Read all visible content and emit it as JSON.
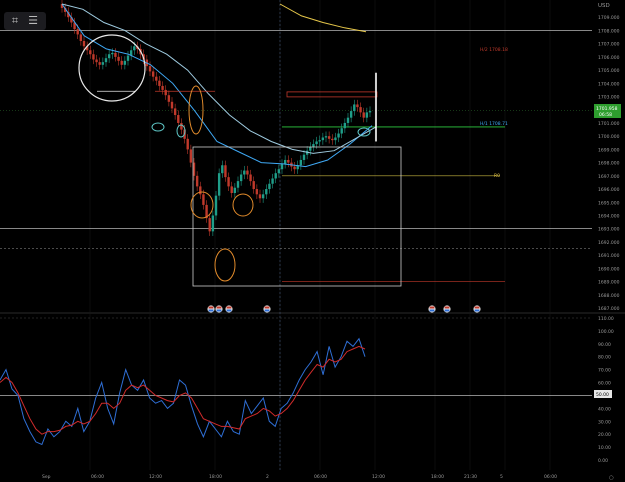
{
  "toolbar": {
    "frame_icon": "frame-icon",
    "list_icon": "list-icon"
  },
  "currency": "USD",
  "colors": {
    "background": "#000000",
    "candle_up": "#1f9e89",
    "candle_down": "#c0392b",
    "ma_fast": "#3fa9f5",
    "ma_mid": "#9ecbe0",
    "ma_slow": "#e6c74a",
    "hline": "#d9d9d9",
    "green_line": "#2ecc40",
    "orange": "#e08a2b",
    "red_box": "#c0392b",
    "osc_blue": "#2f6fd6",
    "osc_red": "#d12b2b",
    "price_tag": "#2e9e2e"
  },
  "chart_data": [
    {
      "type": "line",
      "title": "",
      "subtitle": "",
      "xlabel": "",
      "ylabel": "USD",
      "ylim": [
        1687.0,
        1710.0
      ],
      "y_ticks": [
        "1709.000",
        "1708.000",
        "1707.000",
        "1706.000",
        "1705.000",
        "1704.000",
        "1703.000",
        "1702.000",
        "1701.000",
        "1700.000",
        "1699.000",
        "1698.000",
        "1697.000",
        "1696.000",
        "1695.000",
        "1694.000",
        "1693.000",
        "1692.000",
        "1691.000",
        "1690.000",
        "1689.000",
        "1688.000",
        "1687.000"
      ],
      "x_ticks": [
        "Sep",
        "06:00",
        "12:00",
        "18:00",
        "2",
        "06:00",
        "12:00",
        "18:00",
        "21:30",
        "5",
        "06:00"
      ],
      "current_price": {
        "value": "1701.958",
        "countdown": "06:58",
        "numeric": 1701.958
      },
      "annotations": {
        "h2": "H/2 1708.18",
        "h1": "H/1 1708.71",
        "r0": "R0"
      },
      "series": [
        {
          "type": "candlestick",
          "x": [
            1,
            2,
            3,
            4,
            5,
            6,
            7,
            8,
            9,
            10,
            11,
            12,
            13,
            14,
            15,
            16,
            17,
            18,
            19,
            20,
            21,
            22,
            23,
            24,
            25,
            26,
            27,
            28,
            29,
            30,
            31,
            32,
            33,
            34,
            35,
            36,
            37,
            38,
            39,
            40,
            41,
            42,
            43,
            44,
            45,
            46,
            47,
            48,
            49,
            50,
            51,
            52,
            53,
            54,
            55,
            56,
            57,
            58,
            59,
            60,
            61,
            62,
            63,
            64,
            65,
            66,
            67,
            68,
            69,
            70,
            71,
            72,
            73,
            74,
            75,
            76,
            77,
            78,
            79,
            80,
            81,
            82,
            83,
            84,
            85,
            86,
            87,
            88,
            89,
            90,
            91,
            92,
            93,
            94,
            95,
            96,
            97,
            98,
            99
          ],
          "open": [
            1710.0,
            1709.7,
            1709.4,
            1709.0,
            1708.6,
            1708.1,
            1707.7,
            1707.2,
            1706.8,
            1706.5,
            1706.2,
            1705.8,
            1705.6,
            1705.4,
            1705.6,
            1705.9,
            1706.2,
            1706.3,
            1706.0,
            1705.7,
            1705.4,
            1705.7,
            1706.1,
            1706.5,
            1706.8,
            1706.6,
            1706.2,
            1705.8,
            1705.3,
            1704.9,
            1704.5,
            1704.2,
            1703.8,
            1703.5,
            1703.1,
            1702.6,
            1702.1,
            1701.6,
            1701.0,
            1700.5,
            1699.8,
            1699.0,
            1698.0,
            1697.0,
            1696.2,
            1695.6,
            1694.8,
            1693.8,
            1692.8,
            1694.0,
            1695.5,
            1697.2,
            1697.8,
            1696.9,
            1696.2,
            1695.7,
            1696.1,
            1696.6,
            1697.1,
            1697.4,
            1697.1,
            1696.6,
            1696.0,
            1695.6,
            1695.3,
            1695.6,
            1696.0,
            1696.4,
            1696.8,
            1697.2,
            1697.5,
            1697.9,
            1698.2,
            1698.0,
            1697.7,
            1697.5,
            1697.8,
            1698.2,
            1698.6,
            1698.9,
            1699.2,
            1699.4,
            1699.6,
            1699.7,
            1699.9,
            1700.0,
            1699.8,
            1699.7,
            1699.9,
            1700.2,
            1700.6,
            1701.0,
            1701.4,
            1701.9,
            1702.4,
            1702.2,
            1701.8,
            1701.4,
            1701.8
          ],
          "close": [
            1709.7,
            1709.4,
            1709.0,
            1708.6,
            1708.1,
            1707.7,
            1707.2,
            1706.8,
            1706.5,
            1706.2,
            1705.8,
            1705.6,
            1705.4,
            1705.6,
            1705.9,
            1706.2,
            1706.3,
            1706.0,
            1705.7,
            1705.4,
            1705.7,
            1706.1,
            1706.5,
            1706.8,
            1706.6,
            1706.2,
            1705.8,
            1705.3,
            1704.9,
            1704.5,
            1704.2,
            1703.8,
            1703.5,
            1703.1,
            1702.6,
            1702.1,
            1701.6,
            1701.0,
            1700.5,
            1699.8,
            1699.0,
            1698.0,
            1697.0,
            1696.2,
            1695.6,
            1694.8,
            1693.8,
            1692.8,
            1694.0,
            1695.5,
            1697.2,
            1697.8,
            1696.9,
            1696.2,
            1695.7,
            1696.1,
            1696.6,
            1697.1,
            1697.4,
            1697.1,
            1696.6,
            1696.0,
            1695.6,
            1695.3,
            1695.6,
            1696.0,
            1696.4,
            1696.8,
            1697.2,
            1697.5,
            1697.9,
            1698.2,
            1698.0,
            1697.7,
            1697.5,
            1697.8,
            1698.2,
            1698.6,
            1698.9,
            1699.2,
            1699.4,
            1699.6,
            1699.7,
            1699.9,
            1700.0,
            1699.8,
            1699.7,
            1699.9,
            1700.2,
            1700.6,
            1701.0,
            1701.4,
            1701.9,
            1702.4,
            1702.2,
            1701.8,
            1701.4,
            1701.8,
            1701.9
          ]
        },
        {
          "name": "",
          "values": [
            1710.0,
            1707.6,
            1706.6,
            1706.2,
            1705.4,
            1704.0,
            1701.9,
            1699.6,
            1698.8,
            1698.0,
            1697.9,
            1697.7,
            1698.2,
            1699.4,
            1700.8
          ]
        },
        {
          "name": "",
          "values": [
            1710.0,
            1709.6,
            1708.6,
            1708.0,
            1707.0,
            1706.2,
            1705.0,
            1703.2,
            1701.6,
            1700.4,
            1699.6,
            1699.0,
            1698.7,
            1698.9,
            1699.8,
            1700.7
          ]
        },
        {
          "name": "",
          "values": [
            1710.0,
            1709.1,
            1708.6,
            1708.2,
            1707.9
          ]
        }
      ],
      "levels": [
        1708.0,
        1693.0,
        1691.5,
        1697.0,
        1689.0,
        1700.7,
        1702.95
      ]
    },
    {
      "type": "line",
      "title": "",
      "ylim": [
        0,
        110
      ],
      "y_ticks": [
        "110.00",
        "100.00",
        "90.00",
        "80.00",
        "70.00",
        "60.00",
        "50.00",
        "40.00",
        "30.00",
        "20.00",
        "10.00",
        "0.00"
      ],
      "level_label": "50.00",
      "series": [
        {
          "name": "",
          "values": [
            62,
            70,
            55,
            50,
            32,
            22,
            14,
            12,
            24,
            18,
            22,
            30,
            26,
            40,
            22,
            30,
            48,
            60,
            40,
            28,
            52,
            70,
            58,
            54,
            62,
            48,
            44,
            46,
            40,
            44,
            62,
            58,
            42,
            28,
            18,
            30,
            24,
            18,
            30,
            22,
            20,
            46,
            36,
            42,
            48,
            30,
            26,
            40,
            44,
            52,
            62,
            70,
            76,
            84,
            66,
            88,
            72,
            80,
            92,
            88,
            94,
            80
          ]
        },
        {
          "name": "",
          "values": [
            60,
            64,
            60,
            52,
            42,
            32,
            24,
            20,
            22,
            22,
            23,
            26,
            27,
            30,
            28,
            30,
            36,
            44,
            44,
            40,
            44,
            54,
            58,
            56,
            58,
            54,
            50,
            48,
            46,
            45,
            50,
            52,
            48,
            40,
            32,
            30,
            28,
            26,
            26,
            25,
            24,
            32,
            34,
            36,
            40,
            38,
            34,
            36,
            40,
            46,
            54,
            62,
            68,
            74,
            72,
            78,
            76,
            78,
            84,
            86,
            88,
            86
          ]
        }
      ]
    }
  ]
}
